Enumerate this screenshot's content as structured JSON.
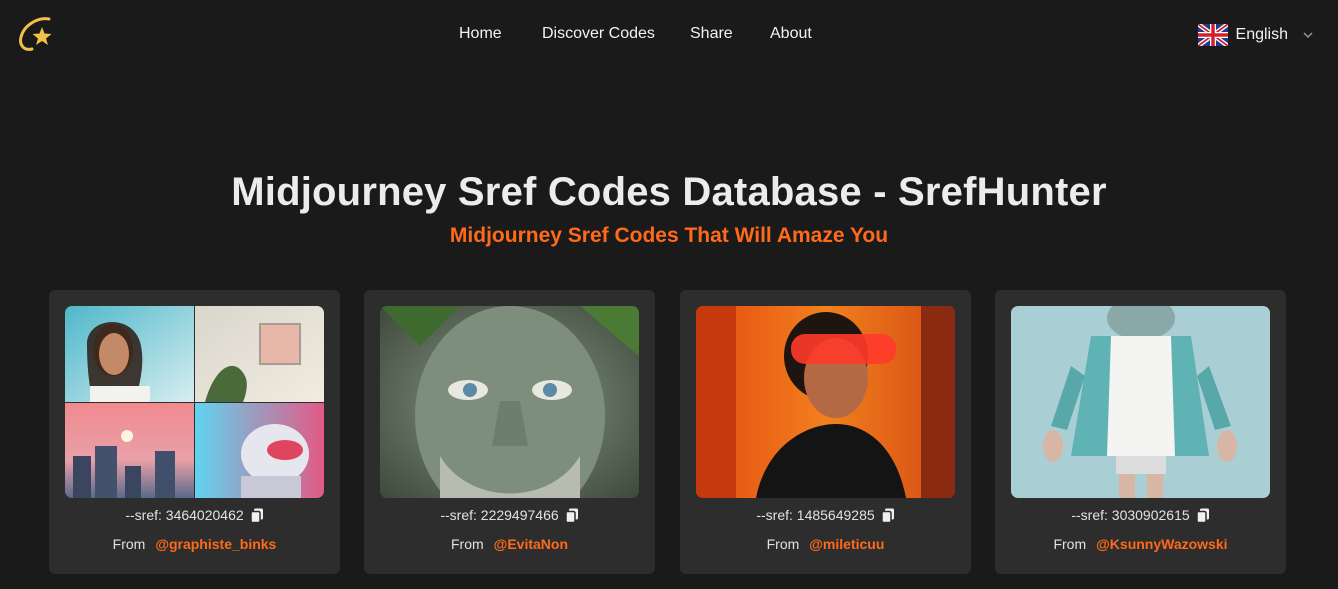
{
  "nav": {
    "links": [
      "Home",
      "Discover Codes",
      "Share",
      "About"
    ]
  },
  "language": {
    "label": "English",
    "flag_icon": "uk-flag-icon"
  },
  "hero": {
    "title": "Midjourney Sref Codes Database - SrefHunter",
    "subtitle": "Midjourney Sref Codes That Will Amaze You"
  },
  "colors": {
    "accent": "#ff6a1a",
    "background": "#1a1a1a",
    "card": "#2d2d2d"
  },
  "cards": [
    {
      "sref": "--sref: 3464020462",
      "from_label": "From",
      "author": "@graphiste_binks"
    },
    {
      "sref": "--sref: 2229497466",
      "from_label": "From",
      "author": "@EvitaNon"
    },
    {
      "sref": "--sref: 1485649285",
      "from_label": "From",
      "author": "@mileticuu"
    },
    {
      "sref": "--sref: 3030902615",
      "from_label": "From",
      "author": "@KsunnyWazowski"
    }
  ]
}
